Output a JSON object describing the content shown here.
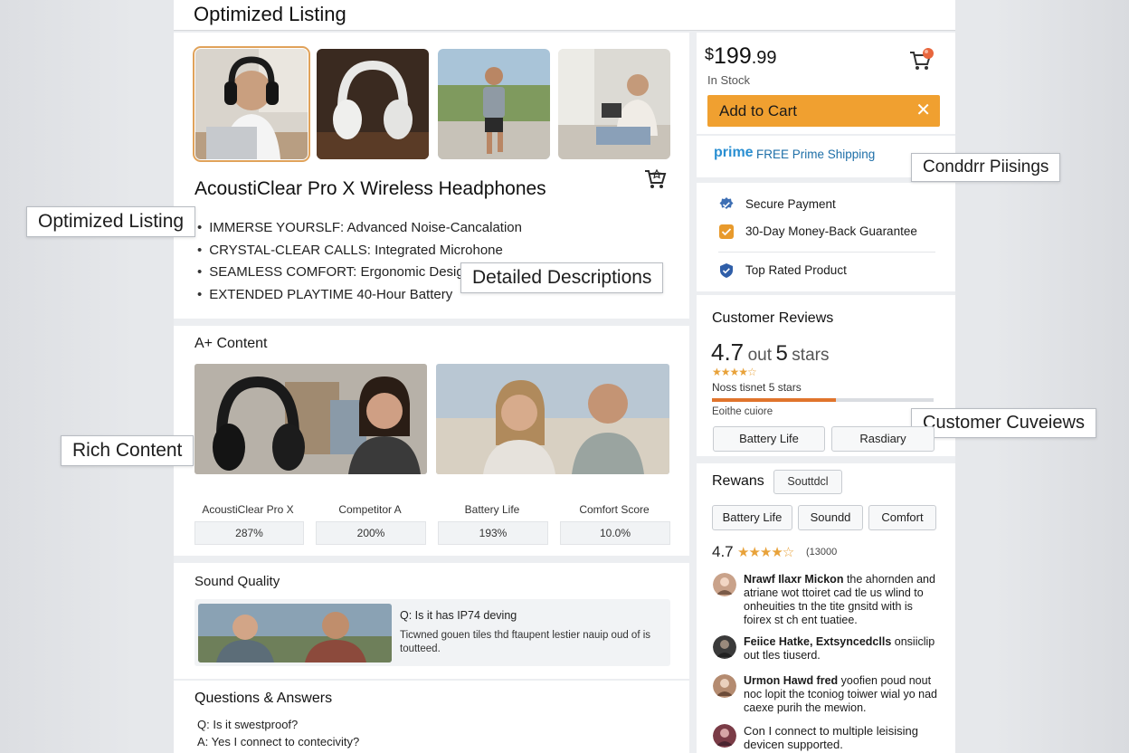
{
  "header": {
    "title": "Optimized Listing"
  },
  "product": {
    "title": "AcoustiClear Pro X Wireless Headphones",
    "bullets": [
      "IMMERSE YOURSLF: Advanced Noise-Cancalation",
      "CRYSTAL-CLEAR CALLS: Integrated Microhone",
      "SEAMLESS COMFORT: Ergonomic Design",
      "EXTENDED PLAYTIME  40-Hour Battery"
    ]
  },
  "callouts": {
    "optimized": "Optimized Listing",
    "detailed": "Detailed Descriptions",
    "rich": "Rich Content",
    "condor": "Conddrr Piisings",
    "cuveiews": "Customer Cuveiews"
  },
  "aplus": {
    "title": "A+ Content",
    "stats": [
      {
        "label": "AcoustiClear Pro X",
        "value": "287%"
      },
      {
        "label": "Competitor A",
        "value": "200%"
      },
      {
        "label": "Battery Life",
        "value": "193%"
      },
      {
        "label": "Comfort Score",
        "value": "10.0%"
      }
    ]
  },
  "sound": {
    "title": "Sound Quality",
    "q": "Q:  Is it has IP74 deving",
    "a": "Ticwned gouen tiles thd ftaupent lestier nauip oud of is toutteed."
  },
  "qa": {
    "title": "Questions & Answers",
    "q": "Q:   Is it swestproof?",
    "a": "A:  Yes I connect to contecivity?"
  },
  "buybox": {
    "currency": "$",
    "price_main": "199",
    "price_frac": ".99",
    "stock": "In Stock",
    "add_to_cart": "Add to Cart",
    "close": "✕",
    "prime": "prime",
    "prime_text": "FREE Prime Shipping"
  },
  "trust": [
    {
      "label": "Secure Payment",
      "color": "#3d6fb4"
    },
    {
      "label": "30-Day Money-Back Guarantee",
      "color": "#e89a2c"
    },
    {
      "label": "Top Rated Product",
      "color": "#2f5ea8"
    }
  ],
  "reviews": {
    "title": "Customer Reviews",
    "rating": "4.7",
    "out": "out",
    "five": "5",
    "stars_word": "stars",
    "stars_glyph": "★★★★☆",
    "subtext": "Noss tisnet 5 stars",
    "bar_fill": 0.56,
    "caption": "Eoithe cuiore",
    "chips": [
      "Battery Life",
      "Rasdiary"
    ]
  },
  "rewans": {
    "title": "Rewans",
    "badge": "Souttdcl",
    "filters": [
      "Battery Life",
      "Soundd",
      "Comfort"
    ],
    "rating": "4.7",
    "stars_glyph": "★★★★☆",
    "count": "(13000",
    "items": [
      {
        "name": "Nrawf Ilaxr Mickon",
        "text": "the ahornden and atriane wot ttoiret cad tle us wlind to onheuities tn the tite gnsitd with is foirex st ch ent tuatiee."
      },
      {
        "name": "Feiice Hatke, Extsyncedclls",
        "text": "onsiiclip out tles tiuserd."
      },
      {
        "name": "Urmon Hawd fred",
        "text": "yoofien poud nout noc lopit the tconiog toiwer wial yo nad caexe purih the mewion."
      },
      {
        "name": "",
        "text": "Con I connect to multiple leisising devicen supported."
      }
    ]
  }
}
